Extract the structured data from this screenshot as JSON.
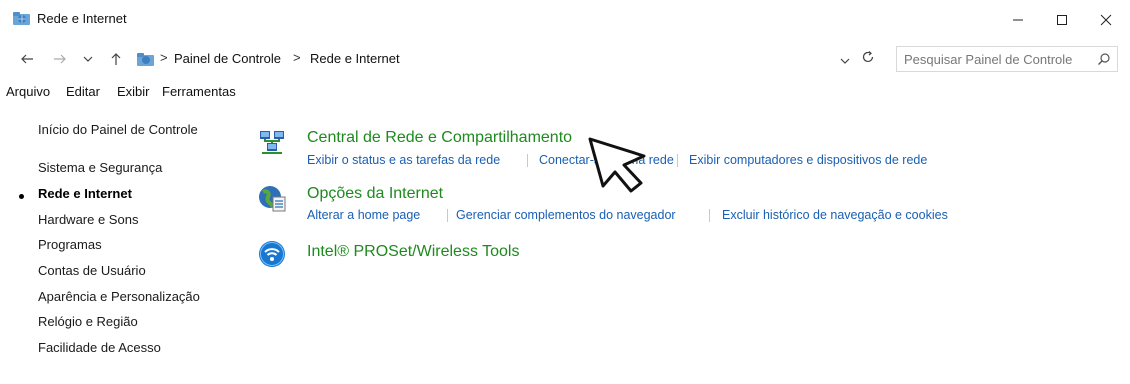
{
  "window": {
    "title": "Rede e Internet",
    "controls": {
      "minimize_icon": "minimize-icon",
      "maximize_icon": "maximize-icon",
      "close_icon": "close-icon"
    }
  },
  "address_bar": {
    "breadcrumbs": [
      "Painel de Controle",
      "Rede e Internet"
    ],
    "separator": ">"
  },
  "search": {
    "placeholder": "Pesquisar Painel de Controle"
  },
  "menu": {
    "items": [
      "Arquivo",
      "Editar",
      "Exibir",
      "Ferramentas"
    ]
  },
  "sidebar": {
    "home": "Início do Painel de Controle",
    "items": [
      {
        "label": "Sistema e Segurança",
        "active": false
      },
      {
        "label": "Rede e Internet",
        "active": true
      },
      {
        "label": "Hardware e Sons",
        "active": false
      },
      {
        "label": "Programas",
        "active": false
      },
      {
        "label": "Contas de Usuário",
        "active": false
      },
      {
        "label": "Aparência e Personalização",
        "active": false
      },
      {
        "label": "Relógio e Região",
        "active": false
      },
      {
        "label": "Facilidade de Acesso",
        "active": false
      }
    ]
  },
  "categories": [
    {
      "title": "Central de Rede e Compartilhamento",
      "icon": "network-sharing-icon",
      "links": [
        "Exibir o status e as tarefas da rede",
        "Conectar-se a uma rede",
        "Exibir computadores e dispositivos de rede"
      ]
    },
    {
      "title": "Opções da Internet",
      "icon": "internet-options-icon",
      "links": [
        "Alterar a home page",
        "Gerenciar complementos do navegador",
        "Excluir histórico de navegação e cookies"
      ]
    },
    {
      "title": "Intel® PROSet/Wireless Tools",
      "icon": "wireless-icon",
      "links": []
    }
  ],
  "colors": {
    "category_title": "#1e8a1e",
    "task_link": "#1a5fb4",
    "text": "#1a1a1a"
  }
}
